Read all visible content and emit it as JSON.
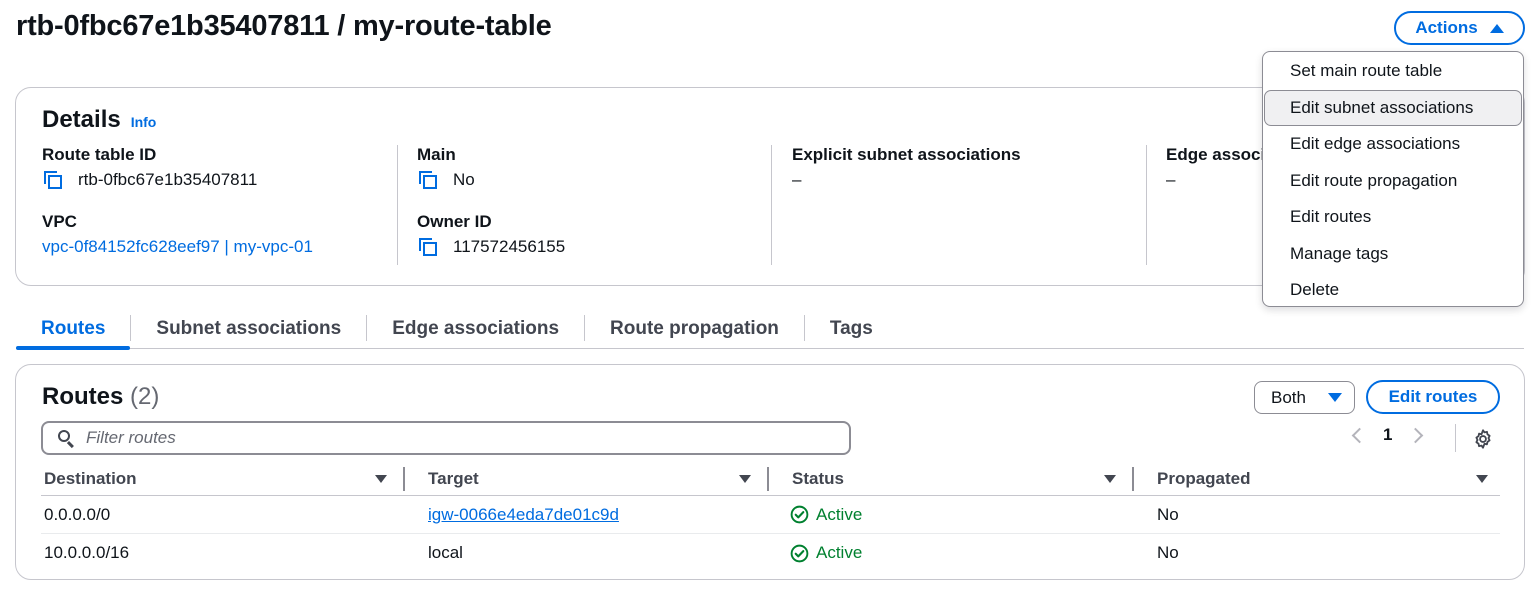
{
  "page": {
    "title": "rtb-0fbc67e1b35407811 / my-route-table"
  },
  "actions": {
    "label": "Actions",
    "menu": [
      "Set main route table",
      "Edit subnet associations",
      "Edit edge associations",
      "Edit route propagation",
      "Edit routes",
      "Manage tags",
      "Delete"
    ],
    "highlighted_index": 1
  },
  "details": {
    "title": "Details",
    "info_label": "Info",
    "route_table_id": {
      "label": "Route table ID",
      "value": "rtb-0fbc67e1b35407811"
    },
    "vpc": {
      "label": "VPC",
      "value": "vpc-0f84152fc628eef97 | my-vpc-01"
    },
    "main": {
      "label": "Main",
      "value": "No"
    },
    "owner_id": {
      "label": "Owner ID",
      "value": "117572456155"
    },
    "explicit_subnet": {
      "label": "Explicit subnet associations",
      "value": "–"
    },
    "edge": {
      "label": "Edge associa",
      "value": "–"
    }
  },
  "tabs": [
    "Routes",
    "Subnet associations",
    "Edge associations",
    "Route propagation",
    "Tags"
  ],
  "active_tab": "Routes",
  "routes": {
    "title": "Routes",
    "count": "(2)",
    "filter_select": "Both",
    "edit_button": "Edit routes",
    "filter_placeholder": "Filter routes",
    "page_number": "1",
    "columns": [
      "Destination",
      "Target",
      "Status",
      "Propagated"
    ],
    "rows": [
      {
        "destination": "0.0.0.0/0",
        "target": "igw-0066e4eda7de01c9d",
        "status": "Active",
        "propagated": "No"
      },
      {
        "destination": "10.0.0.0/16",
        "target": "local",
        "status": "Active",
        "propagated": "No"
      }
    ]
  },
  "colors": {
    "accent": "#006ce0",
    "success": "#00802f",
    "border": "#c6c6cd",
    "text": "#0f141a"
  }
}
